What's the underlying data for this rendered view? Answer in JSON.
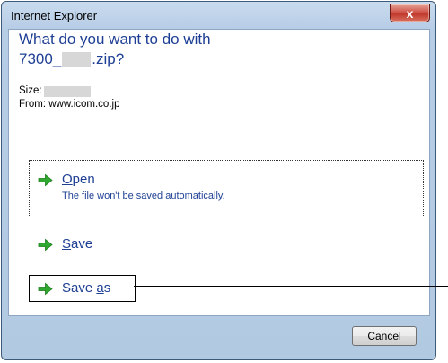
{
  "window": {
    "title": "Internet Explorer",
    "close_glyph": "x"
  },
  "dialog": {
    "heading_line1": "What do you want to do with",
    "filename_prefix": "7300_",
    "filename_suffix": ".zip?",
    "size_label": "Size:",
    "from_text": "From: www.icom.co.jp"
  },
  "options": {
    "open": {
      "label_first": "O",
      "label_rest": "pen",
      "description": "The file won't be saved automatically."
    },
    "save": {
      "label_first": "S",
      "label_rest": "ave"
    },
    "save_as": {
      "label_prefix": "Save ",
      "label_ul": "a",
      "label_rest": "s"
    }
  },
  "buttons": {
    "cancel": "Cancel"
  },
  "colors": {
    "accent_text": "#1e3f94",
    "arrow_green": "#2fa82f",
    "close_red": "#c0392b"
  }
}
